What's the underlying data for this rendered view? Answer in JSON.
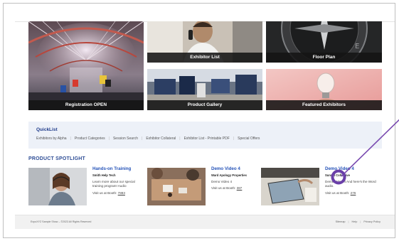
{
  "tiles": [
    {
      "label": "Registration OPEN"
    },
    {
      "label": "Exhibitor List"
    },
    {
      "label": "Floor Plan"
    },
    {
      "label": "Product Gallery"
    },
    {
      "label": "Featured Exhibitors"
    }
  ],
  "quicklist": {
    "title": "QuickList",
    "links": [
      "Exhibitors by Alpha",
      "Product Categories",
      "Session Search",
      "Exhibitor Collateral",
      "Exhibitor List - Printable PDF",
      "Special Offers"
    ]
  },
  "spotlight": {
    "heading": "PRODUCT SPOTLIGHT",
    "items": [
      {
        "title": "Hands-on Training",
        "company": "Smith Help Tech",
        "description": "Learn more about our special training program! Audio",
        "booth_prefix": "Visit us at Booth:",
        "booth": "7883"
      },
      {
        "title": "Demo Video 4",
        "company": "Ward Apology Properties",
        "description": "Demo Video 4",
        "booth_prefix": "Visit us at Booth:",
        "booth": "387"
      },
      {
        "title": "Demo Video 4",
        "company": "Sunset Collective",
        "description": "Demo Video 4 And here's the Word audio.",
        "booth_prefix": "Visit us at Booth:",
        "booth": "276"
      }
    ]
  },
  "footer": {
    "copyright": "ExpoXYZ Sample Show – ©2023 All Rights Reserved",
    "links": [
      "Sitemap",
      "Help",
      "Privacy Policy"
    ]
  },
  "colors": {
    "accent": "#2553b8",
    "heading": "#2f4e96",
    "quicklist_bg": "#edf1f8",
    "annotation": "#7a4bb0"
  }
}
